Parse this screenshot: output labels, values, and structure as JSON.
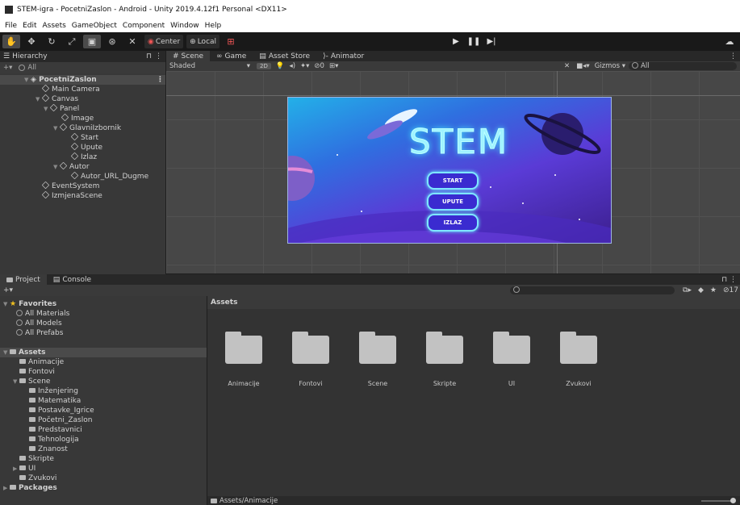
{
  "window": {
    "title": "STEM-igra - PocetniZaslon - Android - Unity 2019.4.12f1 Personal <DX11>"
  },
  "menu": [
    "File",
    "Edit",
    "Assets",
    "GameObject",
    "Component",
    "Window",
    "Help"
  ],
  "toolbar": {
    "pivot": "Center",
    "space": "Local"
  },
  "hierarchy": {
    "tab": "Hierarchy",
    "search_placeholder": "All",
    "items": [
      {
        "label": "PocetniZaslon",
        "depth": 0
      },
      {
        "label": "Main Camera",
        "depth": 1
      },
      {
        "label": "Canvas",
        "depth": 1
      },
      {
        "label": "Panel",
        "depth": 2
      },
      {
        "label": "Image",
        "depth": 3
      },
      {
        "label": "GlavniIzbornik",
        "depth": 2
      },
      {
        "label": "Start",
        "depth": 3
      },
      {
        "label": "Upute",
        "depth": 3
      },
      {
        "label": "Izlaz",
        "depth": 3
      },
      {
        "label": "Autor",
        "depth": 2
      },
      {
        "label": "Autor_URL_Dugme",
        "depth": 3
      },
      {
        "label": "EventSystem",
        "depth": 1
      },
      {
        "label": "IzmjenaScene",
        "depth": 1
      }
    ]
  },
  "scene_tabs": {
    "scene": "Scene",
    "game": "Game",
    "asset_store": "Asset Store",
    "animator": "Animator"
  },
  "scene_toolbar": {
    "shading": "Shaded",
    "mode2d": "2D",
    "hidden": "0",
    "gizmos": "Gizmos",
    "search_placeholder": "All"
  },
  "game_view": {
    "title": "STEM",
    "buttons": [
      "START",
      "UPUTE",
      "IZLAZ"
    ]
  },
  "project": {
    "tabs": {
      "project": "Project",
      "console": "Console"
    },
    "hidden_count": "17",
    "favorites": {
      "label": "Favorites",
      "items": [
        "All Materials",
        "All Models",
        "All Prefabs"
      ]
    },
    "tree": [
      {
        "label": "Assets",
        "depth": 0
      },
      {
        "label": "Animacije",
        "depth": 1
      },
      {
        "label": "Fontovi",
        "depth": 1
      },
      {
        "label": "Scene",
        "depth": 1
      },
      {
        "label": "Inženjering",
        "depth": 2
      },
      {
        "label": "Matematika",
        "depth": 2
      },
      {
        "label": "Postavke_Igrice",
        "depth": 2
      },
      {
        "label": "Početni_Zaslon",
        "depth": 2
      },
      {
        "label": "Predstavnici",
        "depth": 2
      },
      {
        "label": "Tehnologija",
        "depth": 2
      },
      {
        "label": "Znanost",
        "depth": 2
      },
      {
        "label": "Skripte",
        "depth": 1
      },
      {
        "label": "UI",
        "depth": 1
      },
      {
        "label": "Zvukovi",
        "depth": 1
      },
      {
        "label": "Packages",
        "depth": 0
      }
    ],
    "breadcrumb": "Assets",
    "folders": [
      "Animacije",
      "Fontovi",
      "Scene",
      "Skripte",
      "UI",
      "Zvukovi"
    ],
    "status_path": "Assets/Animacije"
  }
}
